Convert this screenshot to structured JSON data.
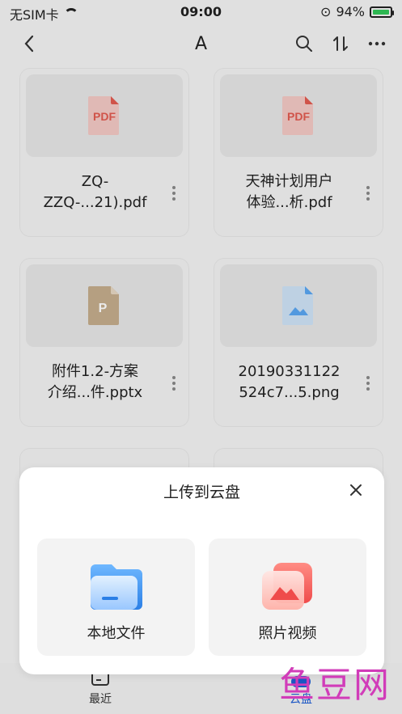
{
  "status": {
    "carrier": "无SIM卡",
    "time": "09:00",
    "battery": "94%"
  },
  "header": {
    "title": "A"
  },
  "files": [
    {
      "name_line1": "ZQ-",
      "name_line2": "ZZQ-...21).pdf",
      "icon": "pdf-icon"
    },
    {
      "name_line1": "天神计划用户",
      "name_line2": "体验...析.pdf",
      "icon": "pdf-icon"
    },
    {
      "name_line1": "附件1.2-方案",
      "name_line2": "介绍...件.pptx",
      "icon": "ppt-icon"
    },
    {
      "name_line1": "20190331122",
      "name_line2": "524c7...5.png",
      "icon": "image-file-icon"
    }
  ],
  "sheet": {
    "title": "上传到云盘",
    "options": [
      {
        "label": "本地文件"
      },
      {
        "label": "照片视频"
      }
    ]
  },
  "tabs": [
    {
      "label": "最近"
    },
    {
      "label": "云盘"
    }
  ],
  "watermark": "鱼豆网",
  "colors": {
    "pdf": "#e25b50",
    "ppt": "#b79a78",
    "image": "#5aa6f2",
    "accent": "#1e5fd6"
  }
}
